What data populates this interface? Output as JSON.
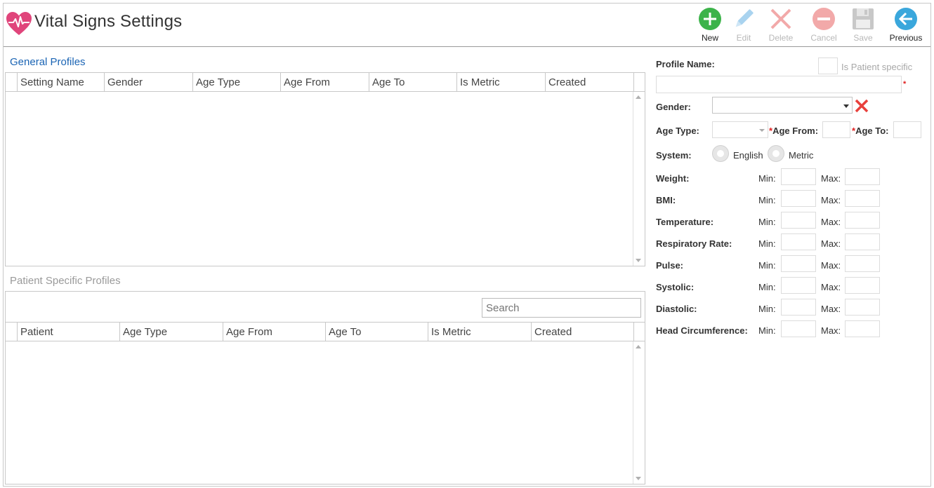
{
  "app": {
    "title": "Vital Signs Settings",
    "logo_icon": "heart-pulse-icon"
  },
  "toolbar": [
    {
      "label": "New",
      "icon": "plus-circle-icon",
      "enabled": true,
      "color": "#3cb34a"
    },
    {
      "label": "Edit",
      "icon": "pencil-icon",
      "enabled": false,
      "color": "#a9d3ef"
    },
    {
      "label": "Delete",
      "icon": "x-icon",
      "enabled": false,
      "color": "#f2a9a9"
    },
    {
      "label": "Cancel",
      "icon": "minus-circle-icon",
      "enabled": false,
      "color": "#f2a9a9"
    },
    {
      "label": "Save",
      "icon": "floppy-disk-icon",
      "enabled": false,
      "color": "#c8c8c8"
    },
    {
      "label": "Previous",
      "icon": "arrow-left-circle-icon",
      "enabled": true,
      "color": "#3aa7dc"
    }
  ],
  "general_profiles": {
    "title": "General Profiles",
    "columns": [
      "Setting Name",
      "Gender",
      "Age Type",
      "Age From",
      "Age To",
      "Is Metric",
      "Created"
    ],
    "rows": []
  },
  "patient_profiles": {
    "title": "Patient Specific Profiles",
    "search_placeholder": "Search",
    "columns": [
      "Patient",
      "Age Type",
      "Age From",
      "Age To",
      "Is Metric",
      "Created"
    ],
    "rows": []
  },
  "form": {
    "profile_name_label": "Profile Name:",
    "profile_name_value": "",
    "is_patient_specific_label": "Is Patient specific",
    "required_mark": "*",
    "gender_label": "Gender:",
    "gender_value": "",
    "age_type_label": "Age Type:",
    "age_type_value": "",
    "age_from_label": "Age From:",
    "age_to_label": "Age To:",
    "system_label": "System:",
    "system_options": [
      "English",
      "Metric"
    ],
    "min_label": "Min:",
    "max_label": "Max:",
    "vitals": [
      "Weight:",
      "BMI:",
      "Temperature:",
      "Respiratory Rate:",
      "Pulse:",
      "Systolic:",
      "Diastolic:",
      "Head Circumference:"
    ]
  },
  "colors": {
    "accent_blue": "#1a64b4",
    "required_red": "#e02020",
    "clear_x_red": "#e8403c"
  }
}
